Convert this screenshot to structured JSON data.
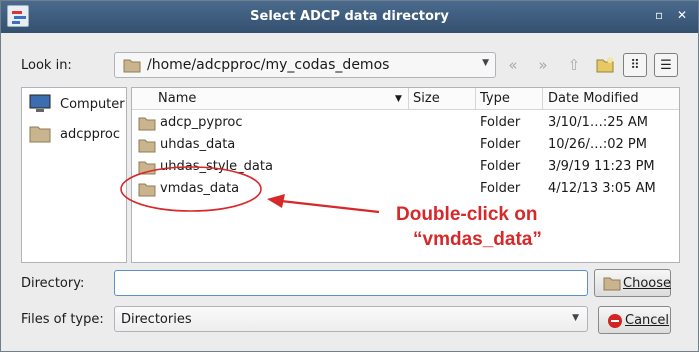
{
  "window": {
    "title": "Select ADCP data directory",
    "minimize_glyph": "▫",
    "close_glyph": "✕"
  },
  "look_in": {
    "label": "Look in:",
    "path": "/home/adcpproc/my_codas_demos"
  },
  "toolbar": {
    "icons": [
      "back-icon",
      "forward-icon",
      "up-directory-icon",
      "new-folder-icon",
      "icon-view-icon",
      "detail-view-icon"
    ]
  },
  "sidebar": {
    "items": [
      {
        "label": "Computer",
        "icon": "computer-icon"
      },
      {
        "label": "adcpproc",
        "icon": "folder-icon"
      }
    ]
  },
  "file_list": {
    "columns": [
      "Name",
      "Size",
      "Type",
      "Date Modified"
    ],
    "rows": [
      {
        "name": "adcp_pyproc",
        "size": "",
        "type": "Folder",
        "date": "3/10/1…:25 AM"
      },
      {
        "name": "uhdas_data",
        "size": "",
        "type": "Folder",
        "date": "10/26/…:02 PM"
      },
      {
        "name": "uhdas_style_data",
        "size": "",
        "type": "Folder",
        "date": "3/9/19 11:23 PM"
      },
      {
        "name": "vmdas_data",
        "size": "",
        "type": "Folder",
        "date": "4/12/13 3:05 AM"
      }
    ]
  },
  "directory": {
    "label": "Directory:",
    "value": ""
  },
  "files_of_type": {
    "label": "Files of type:",
    "value": "Directories"
  },
  "buttons": {
    "choose": "Choose",
    "cancel": "Cancel"
  },
  "annotation": {
    "line1": "Double-click on",
    "line2": "“vmdas_data”",
    "color": "#d7282a"
  },
  "colors": {
    "titlebar": "#3f5e80",
    "folder": "#c9b48d",
    "selection_border": "#5b8fcf"
  }
}
